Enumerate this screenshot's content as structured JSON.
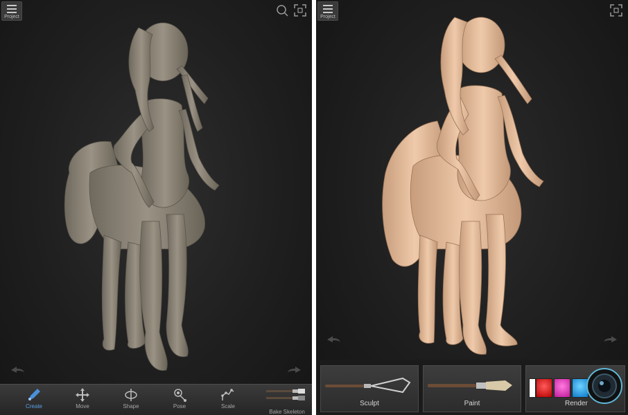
{
  "left_panel": {
    "project_label": "Project",
    "toolbar": [
      {
        "label": "Create",
        "icon": "create-pen-icon",
        "active": true
      },
      {
        "label": "Move",
        "icon": "move-arrows-icon",
        "active": false
      },
      {
        "label": "Shape",
        "icon": "shape-icon",
        "active": false
      },
      {
        "label": "Pose",
        "icon": "pose-icon",
        "active": false
      },
      {
        "label": "Scale",
        "icon": "scale-icon",
        "active": false
      }
    ],
    "bake_label": "Bake Skeleton",
    "colors": {
      "model": "#8a8375",
      "active": "#4a90d9"
    }
  },
  "right_panel": {
    "project_label": "Project",
    "modes": [
      {
        "label": "Sculpt",
        "icon": "sculpt-tool-icon"
      },
      {
        "label": "Paint",
        "icon": "paint-brush-icon"
      },
      {
        "label": "Render",
        "icon": "camera-lens-icon"
      }
    ],
    "colors": {
      "model": "#e2b999"
    }
  }
}
